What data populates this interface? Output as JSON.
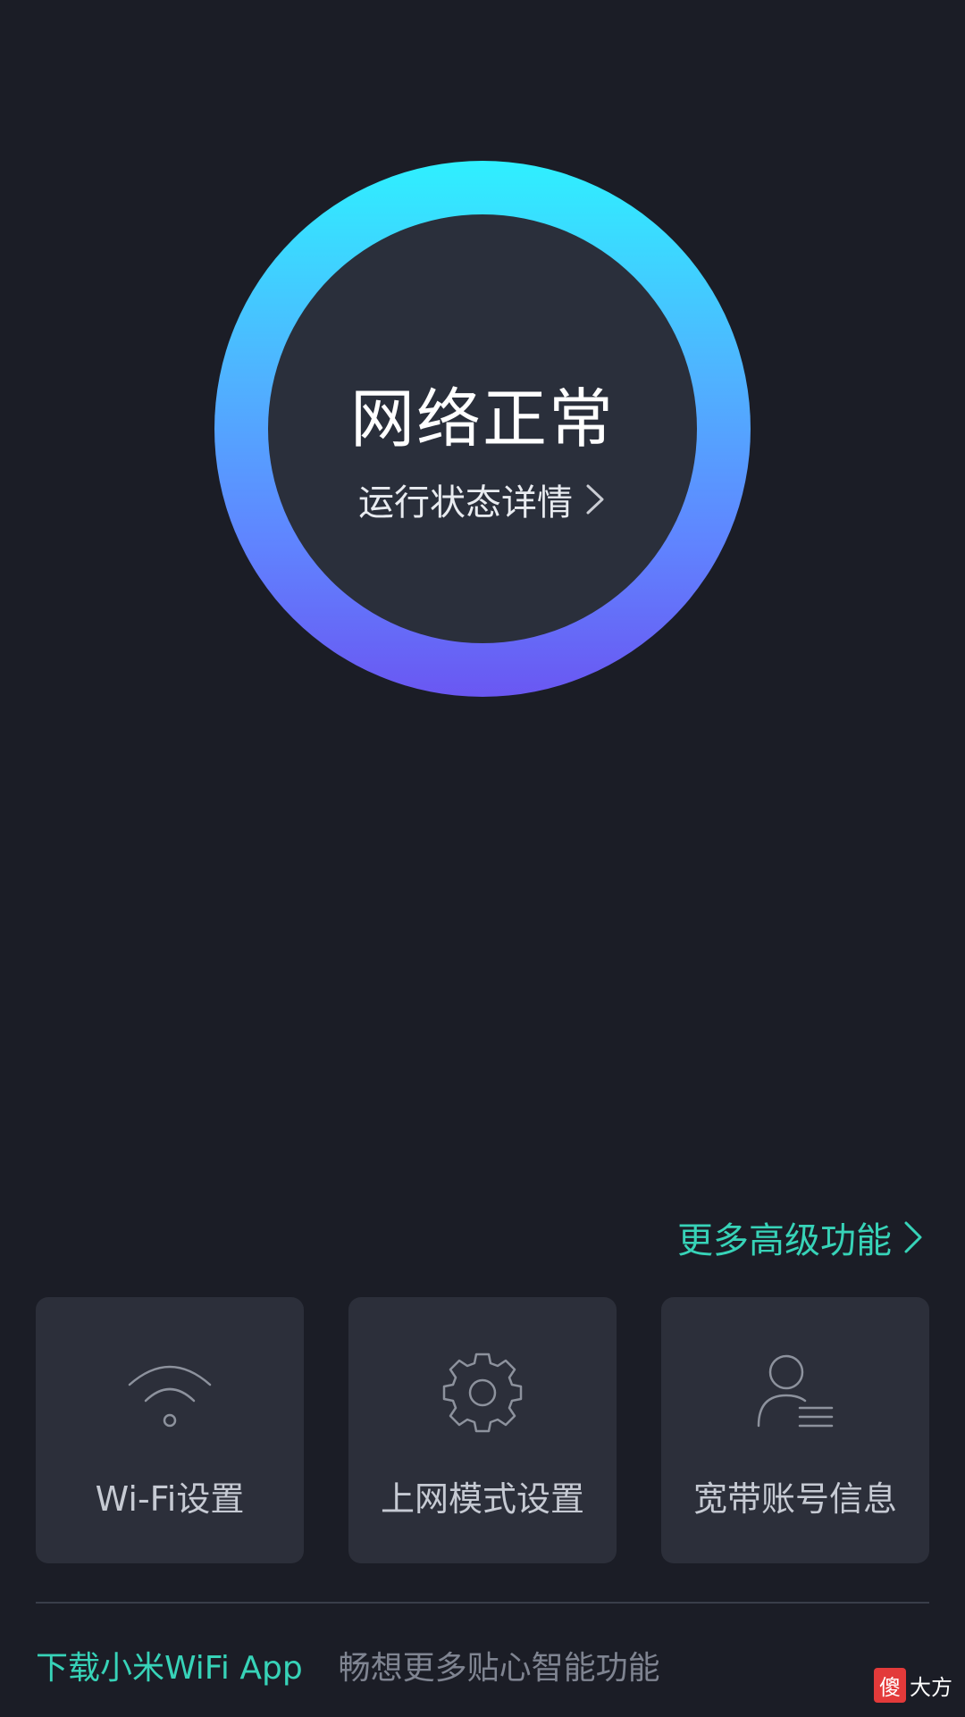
{
  "status": {
    "title": "网络正常",
    "details_label": "运行状态详情"
  },
  "more_features": {
    "label": "更多高级功能"
  },
  "tiles": [
    {
      "label": "Wi-Fi设置",
      "icon": "wifi-icon"
    },
    {
      "label": "上网模式设置",
      "icon": "gear-icon"
    },
    {
      "label": "宽带账号信息",
      "icon": "user-info-icon"
    }
  ],
  "footer": {
    "download_label": "下载小米WiFi App",
    "description": "畅想更多贴心智能功能"
  },
  "watermark": {
    "part_a": "傻",
    "part_b": "大方"
  },
  "colors": {
    "background": "#1b1d26",
    "ring_top": "#2ff0ff",
    "ring_bottom": "#6a57f2",
    "accent": "#37d3b8",
    "tile_bg": "#2c2f3a"
  }
}
